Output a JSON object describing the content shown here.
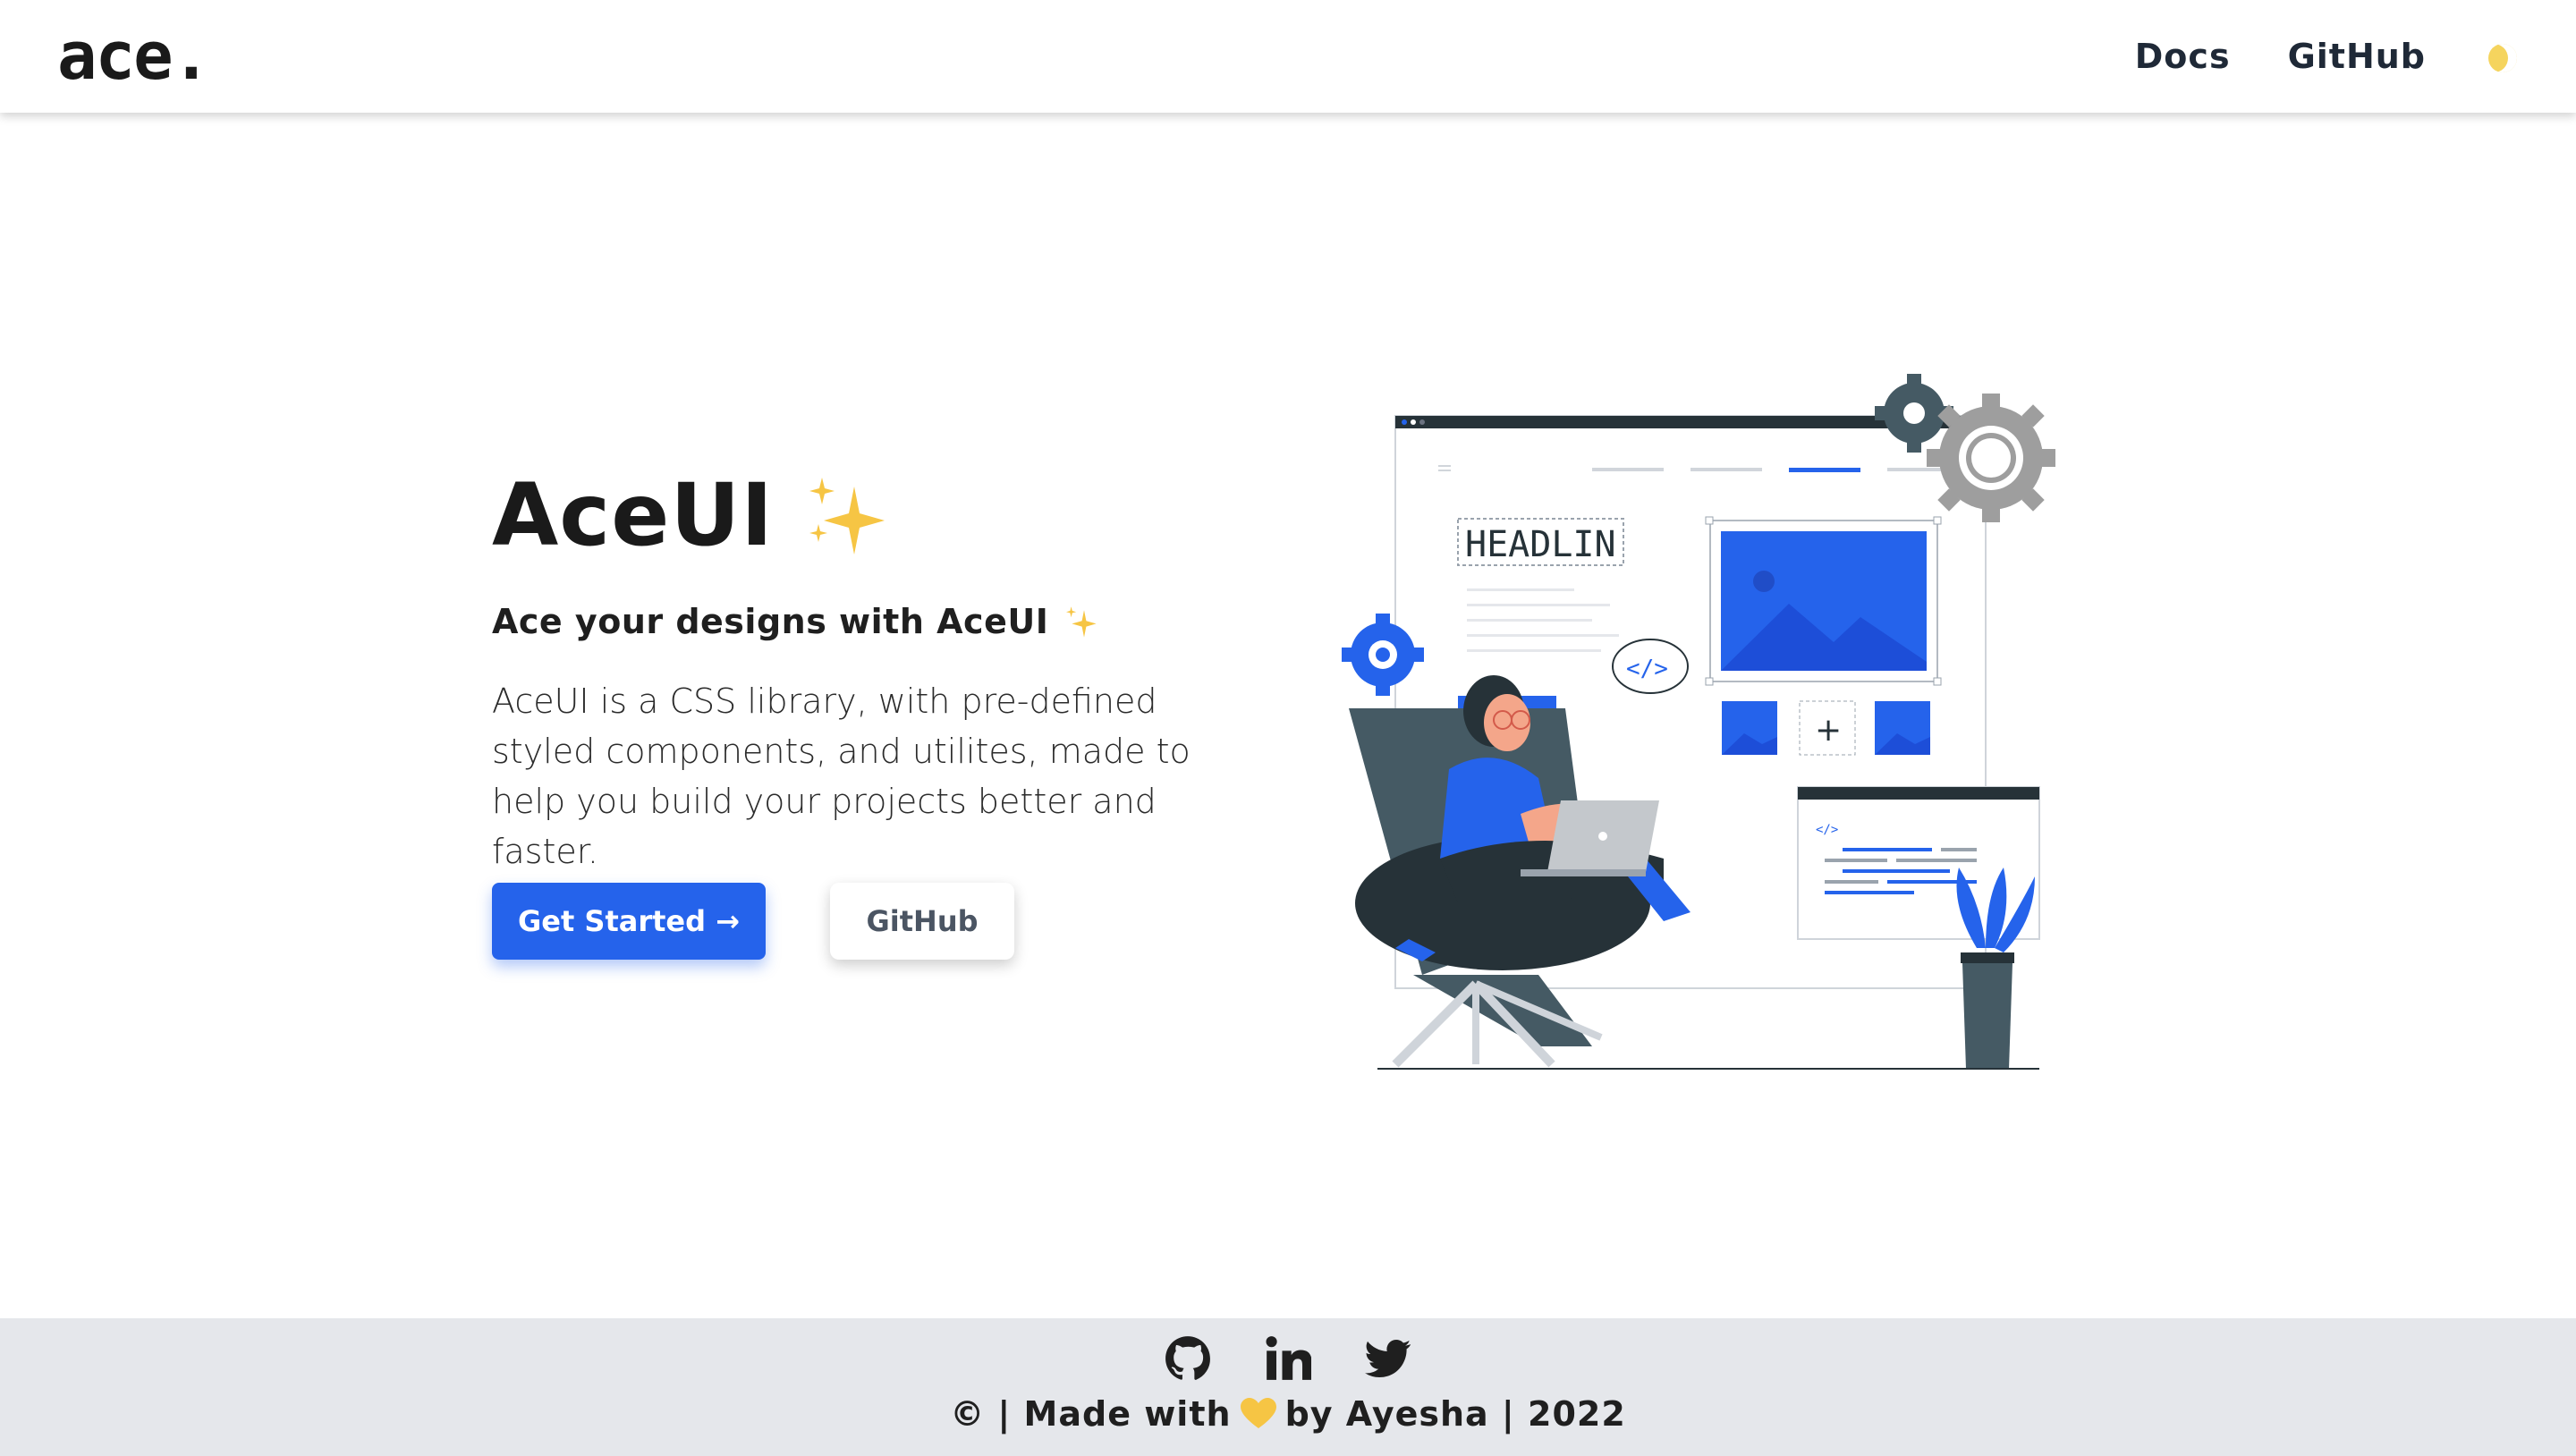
{
  "nav": {
    "logo": "ace.",
    "links": [
      {
        "label": "Docs"
      },
      {
        "label": "GitHub"
      }
    ],
    "theme_icon": "moon-icon"
  },
  "hero": {
    "title": "AceUI",
    "title_icon": "sparkles-icon",
    "subtitle": "Ace your designs with AceUI",
    "subtitle_icon": "sparkles-icon",
    "description": "AceUI is a CSS library, with pre-defined styled components, and utilites, made to help you build your projects better and faster.",
    "primary_button": "Get Started →",
    "secondary_button": "GitHub",
    "illustration": {
      "headline_text": "HEADLIN",
      "code_badge": "</>",
      "code_window_tag": "</>"
    }
  },
  "footer": {
    "socials": [
      "github-icon",
      "linkedin-icon",
      "twitter-icon"
    ],
    "text_before": "© | Made with",
    "heart_icon": "yellow-heart-icon",
    "text_after": "by Ayesha | 2022"
  },
  "colors": {
    "accent": "#2563eb",
    "dark": "#1f2937",
    "footer_bg": "#e5e7eb",
    "sparkle": "#f2c94c"
  }
}
